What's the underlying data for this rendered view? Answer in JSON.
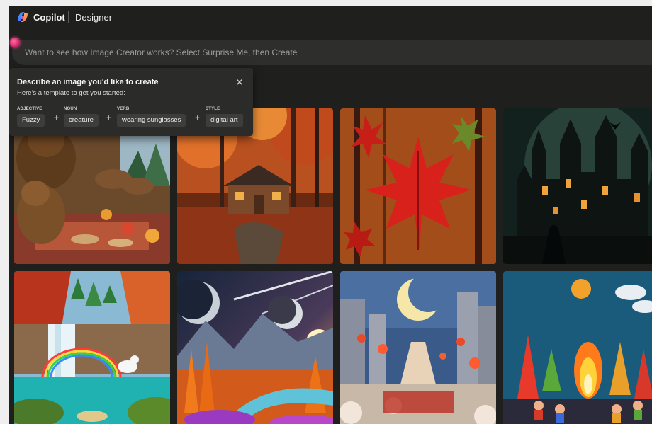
{
  "header": {
    "brand": "Copilot",
    "product": "Designer",
    "logo_icon": "copilot-logo-icon"
  },
  "prompt": {
    "placeholder": "Want to see how Image Creator works? Select Surprise Me, then Create"
  },
  "popover": {
    "title": "Describe an image you'd like to create",
    "subtitle": "Here's a template to get you started:",
    "close_icon": "close-icon",
    "template": [
      {
        "label": "ADJECTIVE",
        "value": "Fuzzy"
      },
      {
        "label": "NOUN",
        "value": "creature"
      },
      {
        "label": "VERB",
        "value": "wearing sunglasses"
      },
      {
        "label": "STYLE",
        "value": "digital art"
      }
    ]
  },
  "gallery": {
    "tiles": [
      {
        "subject": "bears-in-cozy-cabin"
      },
      {
        "subject": "autumn-forest-cabin"
      },
      {
        "subject": "red-maple-leaf"
      },
      {
        "subject": "dark-gothic-castle"
      },
      {
        "subject": "waterfall-rainbow-unicorn"
      },
      {
        "subject": "alien-planets-landscape"
      },
      {
        "subject": "crescent-moon-city-lanterns"
      },
      {
        "subject": "clay-fire-village"
      }
    ]
  },
  "colors": {
    "app_bg": "#1f1f1e",
    "prompt_bg": "#2e2e2d",
    "popover_bg": "#2b2b2a",
    "chip_bg": "#3d3d3c",
    "accent_pink": "#d2276a"
  }
}
